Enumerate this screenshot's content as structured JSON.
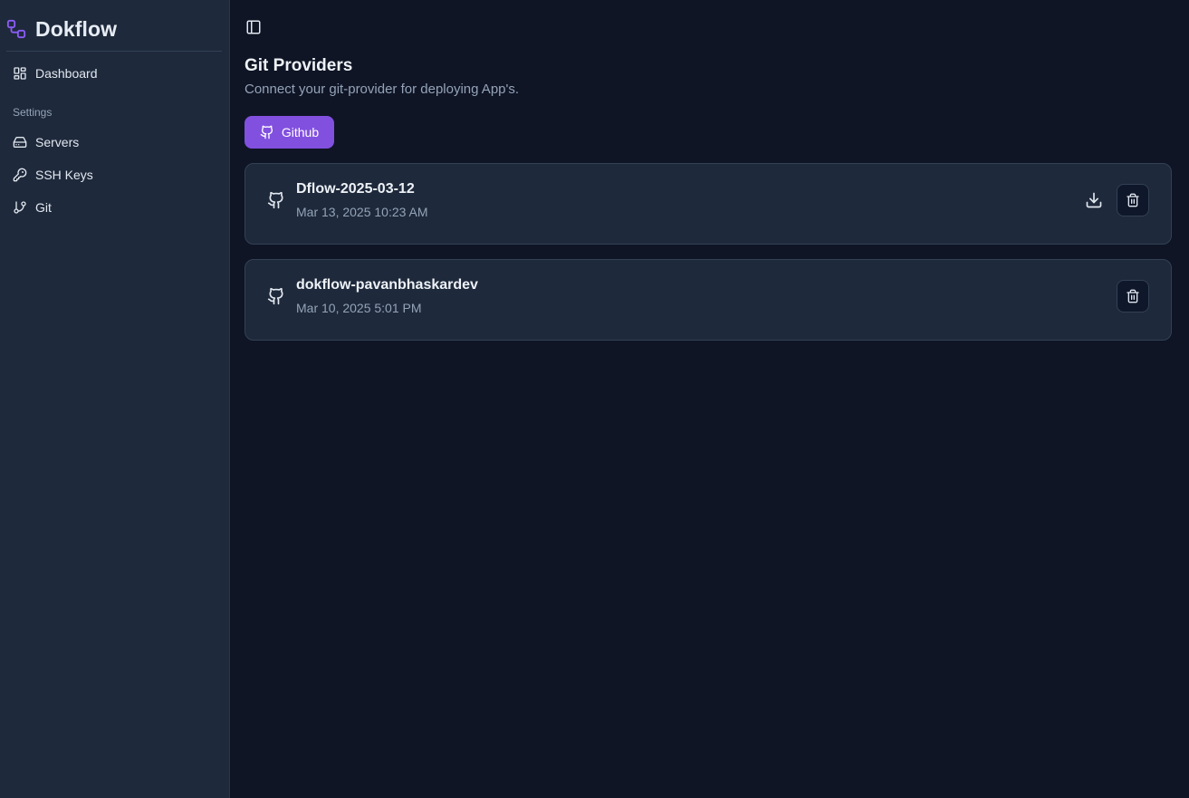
{
  "brand": {
    "name": "Dokflow",
    "logo_icon": "workflow-icon",
    "accent": "#8b5cf6"
  },
  "sidebar": {
    "items": [
      {
        "label": "Dashboard",
        "icon": "layout-dashboard-icon"
      }
    ],
    "section_label": "Settings",
    "settings_items": [
      {
        "label": "Servers",
        "icon": "hard-drive-icon"
      },
      {
        "label": "SSH Keys",
        "icon": "key-icon"
      },
      {
        "label": "Git",
        "icon": "git-branch-icon"
      }
    ]
  },
  "header": {
    "toggle_icon": "panel-left-icon"
  },
  "main": {
    "title": "Git Providers",
    "subtitle": "Connect your git-provider for deploying App's.",
    "github_button": {
      "label": "Github",
      "icon": "github-icon",
      "color": "#8250df"
    },
    "providers": [
      {
        "name": "Dflow-2025-03-12",
        "date": "Mar 13, 2025 10:23 AM",
        "has_download": true
      },
      {
        "name": "dokflow-pavanbhaskardev",
        "date": "Mar 10, 2025 5:01 PM",
        "has_download": false
      }
    ]
  }
}
